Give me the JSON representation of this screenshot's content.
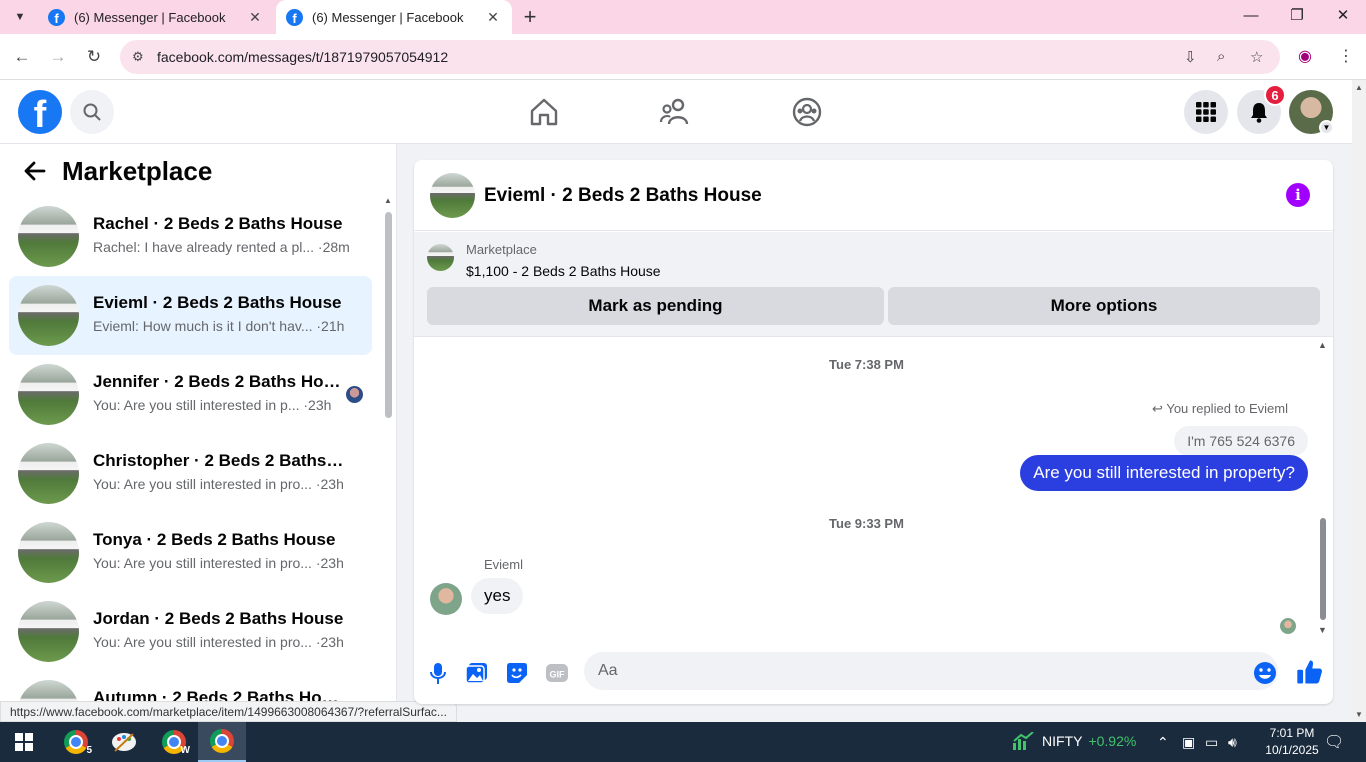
{
  "browser": {
    "tabs": [
      {
        "title": "(6) Messenger | Facebook",
        "active": false
      },
      {
        "title": "(6) Messenger | Facebook",
        "active": true
      }
    ],
    "url": "facebook.com/messages/t/1871979057054912",
    "status_url": "https://www.facebook.com/marketplace/item/1499663008064367/?referralSurfac..."
  },
  "fb_header": {
    "notification_count": "6",
    "logo_letter": "f"
  },
  "left_panel": {
    "title": "Marketplace",
    "conversations": [
      {
        "name": "Rachel · 2 Beds 2 Baths House",
        "snippet": "Rachel: I have already rented a pl...",
        "time": "·28m",
        "selected": false
      },
      {
        "name": "Evieml · 2 Beds 2 Baths House",
        "snippet": "Evieml: How much is it I don't hav...",
        "time": "·21h",
        "selected": true
      },
      {
        "name": "Jennifer · 2 Beds 2 Baths House",
        "snippet": "You: Are you still interested in p...",
        "time": "·23h",
        "selected": false
      },
      {
        "name": "Christopher · 2 Beds 2 Baths Ho...",
        "snippet": "You: Are you still interested in pro...",
        "time": "·23h",
        "selected": false
      },
      {
        "name": "Tonya · 2 Beds 2 Baths House",
        "snippet": "You: Are you still interested in pro...",
        "time": "·23h",
        "selected": false
      },
      {
        "name": "Jordan · 2 Beds 2 Baths House",
        "snippet": "You: Are you still interested in pro...",
        "time": "·23h",
        "selected": false
      },
      {
        "name": "Autumn · 2 Beds 2 Baths House",
        "snippet": "",
        "time": "",
        "selected": false
      }
    ]
  },
  "chat": {
    "title": "Evieml · 2 Beds 2 Baths House",
    "marketplace": {
      "label": "Marketplace",
      "listing": "$1,100 - 2 Beds 2 Baths House",
      "mark_pending": "Mark as pending",
      "more_options": "More options"
    },
    "timestamp_1": "Tue 7:38 PM",
    "replied_note": "You replied to Evieml",
    "replied_quote": "I'm 765 524 6376",
    "outgoing_message": "Are you still interested in property?",
    "timestamp_2": "Tue 9:33 PM",
    "sender_name": "Evieml",
    "incoming_message": "yes",
    "composer_placeholder": "Aa",
    "info_glyph": "i"
  },
  "taskbar": {
    "chrome_badge": "5",
    "chrome_badge_2": "W",
    "stock_name": "NIFTY",
    "stock_change": "+0.92%",
    "time": "7:01 PM",
    "date": "10/1/2025"
  },
  "colors": {
    "fb_blue": "#1877f2",
    "outgoing_bubble": "#2b3fe0",
    "info_purple": "#a100ff",
    "badge_red": "#e41e3f",
    "selected_row": "#e7f3ff"
  }
}
